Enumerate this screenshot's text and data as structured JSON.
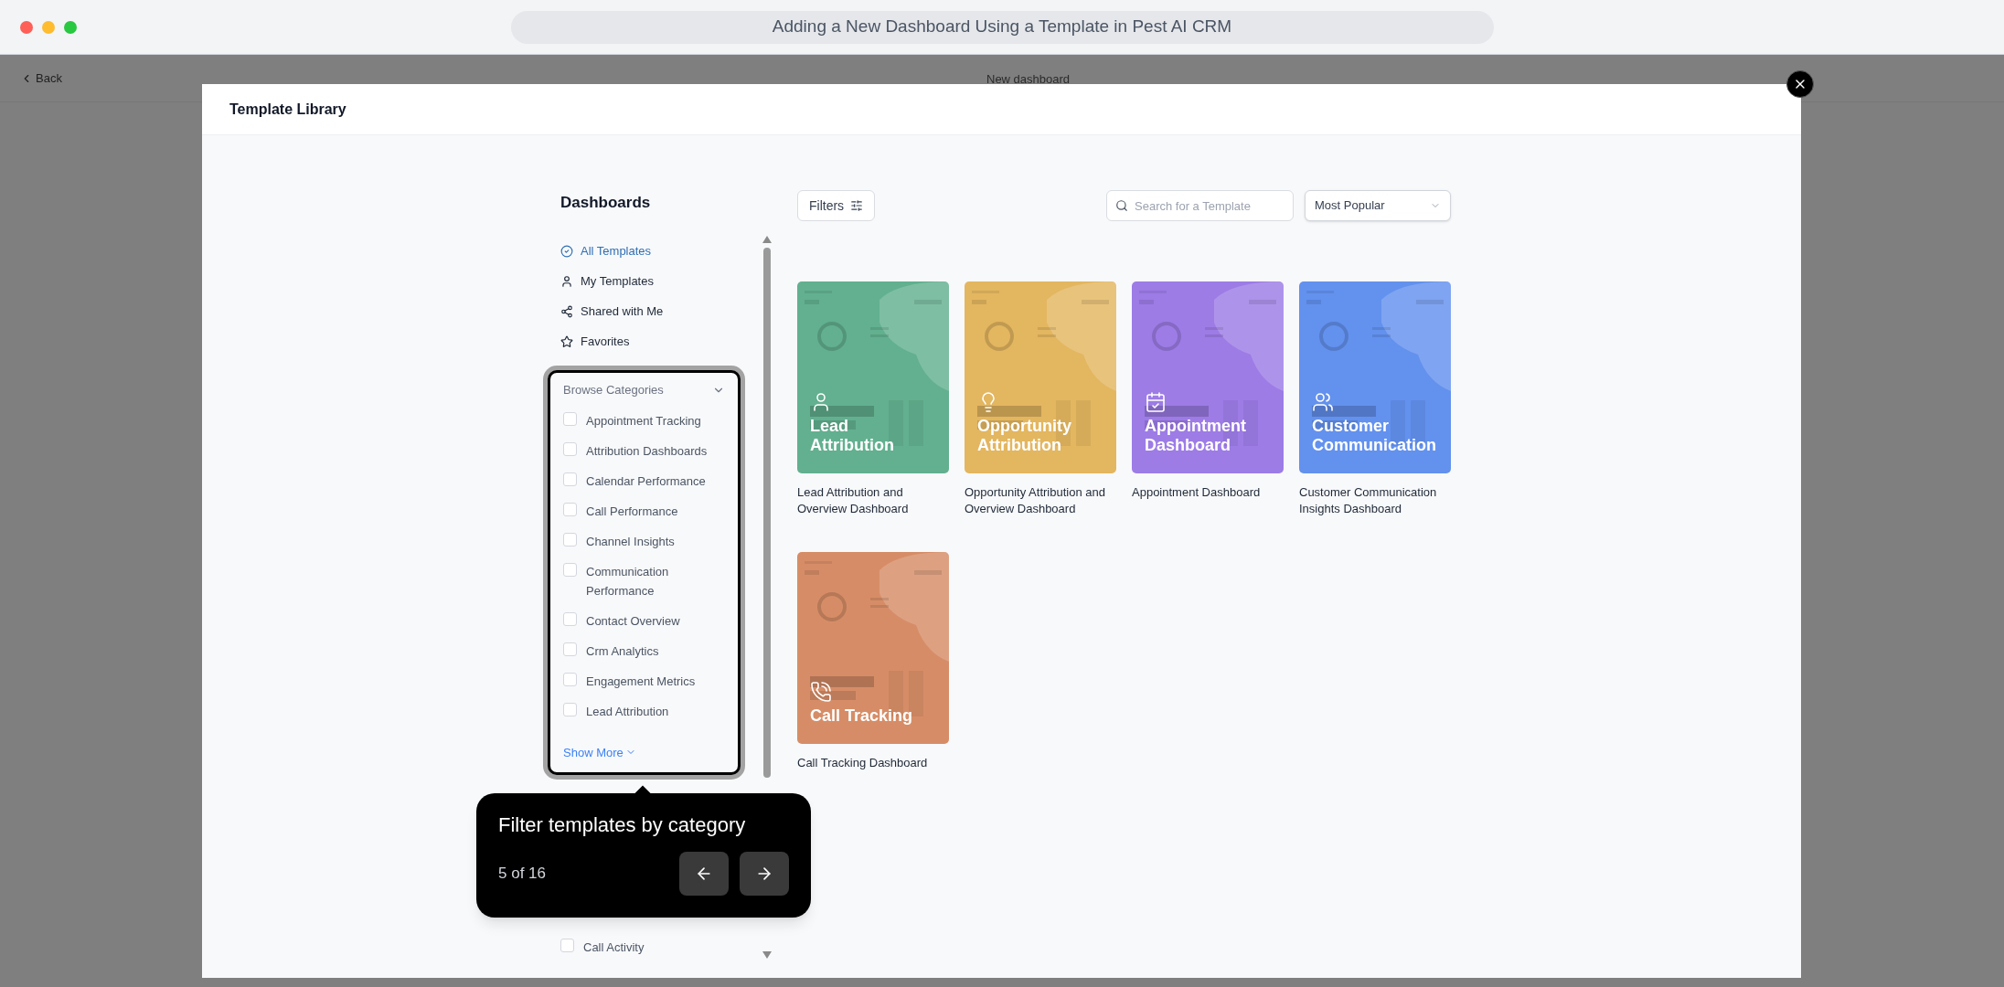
{
  "window": {
    "title": "Adding a New Dashboard Using a Template in Pest AI CRM"
  },
  "background_page": {
    "back_label": "Back",
    "title": "New dashboard"
  },
  "modal": {
    "title": "Template Library"
  },
  "sidebar": {
    "heading": "Dashboards",
    "items": [
      {
        "label": "All Templates",
        "kind": "all",
        "selected": true
      },
      {
        "label": "My Templates",
        "kind": "mine",
        "selected": false
      },
      {
        "label": "Shared with Me",
        "kind": "shared",
        "selected": false
      },
      {
        "label": "Favorites",
        "kind": "favorites",
        "selected": false
      }
    ],
    "categories": {
      "title": "Browse Categories",
      "expanded": true,
      "items": [
        {
          "label": "Appointment Tracking",
          "checked": false
        },
        {
          "label": "Attribution Dashboards",
          "checked": false
        },
        {
          "label": "Calendar Performance",
          "checked": false
        },
        {
          "label": "Call Performance",
          "checked": false
        },
        {
          "label": "Channel Insights",
          "checked": false
        },
        {
          "label": "Communication Performance",
          "checked": false
        },
        {
          "label": "Contact Overview",
          "checked": false
        },
        {
          "label": "Crm Analytics",
          "checked": false
        },
        {
          "label": "Engagement Metrics",
          "checked": false
        },
        {
          "label": "Lead Attribution",
          "checked": false
        }
      ],
      "show_more": "Show More",
      "more_items": [
        {
          "label": "Call Activity",
          "checked": false
        }
      ]
    }
  },
  "toolbar": {
    "filters": "Filters",
    "search_placeholder": "Search for a Template",
    "sort": "Most Popular"
  },
  "templates": [
    {
      "title": "Lead Attribution",
      "name": "Lead Attribution and Overview Dashboard",
      "kind": "person",
      "color": "#62b08f"
    },
    {
      "title": "Opportunity Attribution",
      "name": "Opportunity Attribution and Overview Dashboard",
      "kind": "bulb",
      "color": "#e3b660"
    },
    {
      "title": "Appointment Dashboard",
      "name": "Appointment Dashboard",
      "kind": "calendar",
      "color": "#9d7ce6"
    },
    {
      "title": "Customer Communication",
      "name": "Customer Communication Insights Dashboard",
      "kind": "people",
      "color": "#6391ee"
    },
    {
      "title": "Call Tracking",
      "name": "Call Tracking Dashboard",
      "kind": "phone",
      "color": "#d68d67"
    }
  ],
  "tour": {
    "text": "Filter templates by category",
    "step": "5 of 16"
  }
}
